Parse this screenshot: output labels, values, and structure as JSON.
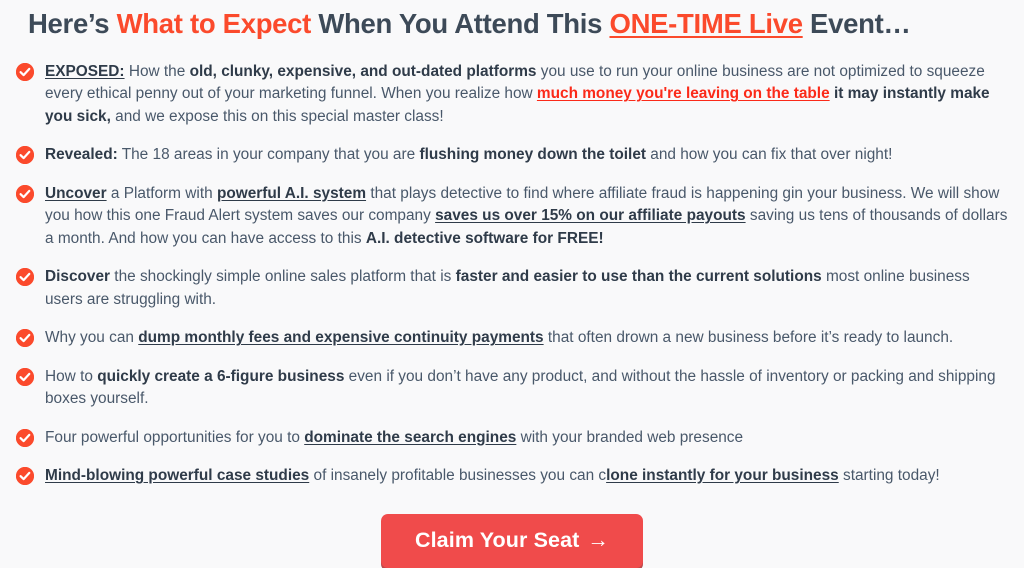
{
  "colors": {
    "background": "#f9f9fa",
    "headline_dark": "#3d4a58",
    "accent_orange": "#fb4a2c",
    "body_text": "#49586a",
    "link_red": "#fb2a19",
    "button_bg": "#f04b4b",
    "button_text": "#ffffff"
  },
  "headline": {
    "part1": "Here’s ",
    "accent1": "What to Expect",
    "part2": " When You Attend This ",
    "accent2": "ONE-TIME Live",
    "part3": " Event…"
  },
  "icons": {
    "check": "check-circle-icon",
    "arrow": "arrow-right-icon"
  },
  "bullets": [
    {
      "id": "bullet-exposed",
      "segments": [
        {
          "text": "EXPOSED:",
          "style": "bold-underline"
        },
        {
          "text": " How the ",
          "style": "normal"
        },
        {
          "text": "old, clunky, expensive, and out-dated platforms",
          "style": "bold"
        },
        {
          "text": " you use to run your online business are not optimized to squeeze every ethical penny out of your marketing funnel. When you realize how ",
          "style": "normal"
        },
        {
          "text": "much money you're leaving on the table",
          "style": "red-underline"
        },
        {
          "text": " ",
          "style": "normal"
        },
        {
          "text": "it may instantly make you sick,",
          "style": "bold"
        },
        {
          "text": " and we expose this on this special master class!",
          "style": "normal"
        }
      ]
    },
    {
      "id": "bullet-revealed",
      "segments": [
        {
          "text": "Revealed:",
          "style": "bold"
        },
        {
          "text": " The 18 areas in your company that you are ",
          "style": "normal"
        },
        {
          "text": "flushing money down the toilet",
          "style": "bold"
        },
        {
          "text": " and how you can fix that over night!",
          "style": "normal"
        }
      ]
    },
    {
      "id": "bullet-uncover",
      "segments": [
        {
          "text": "Uncover",
          "style": "bold-underline"
        },
        {
          "text": " a Platform with ",
          "style": "normal"
        },
        {
          "text": "powerful A.I. system",
          "style": "bold-underline"
        },
        {
          "text": " that plays detective to find where affiliate fraud is happening gin your business. We will show you how this one Fraud Alert system saves our company ",
          "style": "normal"
        },
        {
          "text": "saves us over 15% on our affiliate payouts",
          "style": "bold-underline"
        },
        {
          "text": " saving us tens of thousands of dollars a month. And how you can have access to this ",
          "style": "normal"
        },
        {
          "text": "A.I. detective software for FREE!",
          "style": "bold"
        }
      ]
    },
    {
      "id": "bullet-discover",
      "segments": [
        {
          "text": "Discover",
          "style": "bold"
        },
        {
          "text": " the shockingly simple online sales platform that is ",
          "style": "normal"
        },
        {
          "text": "faster and easier to use than the current solutions",
          "style": "bold"
        },
        {
          "text": " most online business users are struggling with.",
          "style": "normal"
        }
      ]
    },
    {
      "id": "bullet-dump-fees",
      "segments": [
        {
          "text": "Why you can ",
          "style": "normal"
        },
        {
          "text": "dump monthly fees and expensive continuity payments",
          "style": "bold-underline"
        },
        {
          "text": " that often drown a new business before it’s ready to launch.",
          "style": "normal"
        }
      ]
    },
    {
      "id": "bullet-six-figure",
      "segments": [
        {
          "text": "How to ",
          "style": "normal"
        },
        {
          "text": "quickly create a 6-figure business",
          "style": "bold"
        },
        {
          "text": " even if you don’t have any product, and without the hassle of inventory or packing and shipping boxes yourself.",
          "style": "normal"
        }
      ]
    },
    {
      "id": "bullet-search-engines",
      "segments": [
        {
          "text": "Four powerful opportunities for you to ",
          "style": "normal"
        },
        {
          "text": "dominate the search engines",
          "style": "bold-underline"
        },
        {
          "text": " with your branded web presence",
          "style": "normal"
        }
      ]
    },
    {
      "id": "bullet-case-studies",
      "segments": [
        {
          "text": "Mind-blowing powerful case studies",
          "style": "bold-underline"
        },
        {
          "text": " of insanely profitable businesses you can c",
          "style": "normal"
        },
        {
          "text": "lone instantly for your business",
          "style": "bold-underline"
        },
        {
          "text": " starting today!",
          "style": "normal"
        }
      ]
    }
  ],
  "cta": {
    "label": "Claim Your Seat",
    "arrow": "→"
  }
}
